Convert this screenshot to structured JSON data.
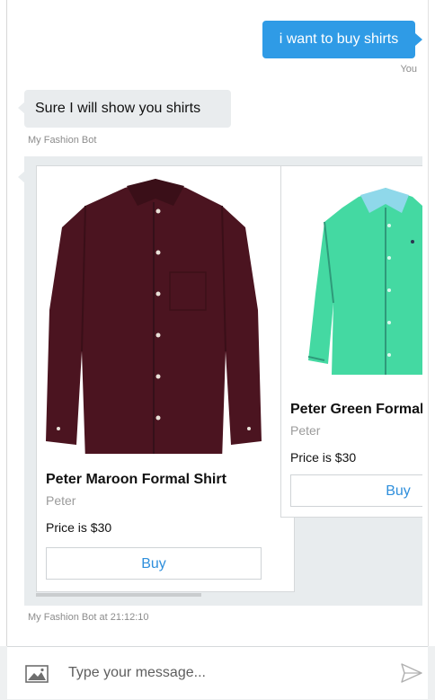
{
  "messages": {
    "user": {
      "text": "i want to buy shirts",
      "sender": "You"
    },
    "bot": {
      "text": "Sure I will show you shirts",
      "sender": "My Fashion Bot"
    }
  },
  "carousel": {
    "items": [
      {
        "title": "Peter Maroon Formal Shirt",
        "brand": "Peter",
        "price": "Price is $30",
        "button_label": "Buy",
        "shirt_color": "#4b1420"
      },
      {
        "title": "Peter Green Formal Shirt",
        "brand": "Peter",
        "price": "Price is $30",
        "button_label": "Buy",
        "shirt_color": "#44d9a2"
      }
    ],
    "timestamp": "My Fashion Bot at 21:12:10"
  },
  "composer": {
    "placeholder": "Type your message...",
    "attach_icon": "image-icon",
    "send_icon": "send-icon"
  },
  "colors": {
    "accent": "#2f9be6",
    "bot_bubble": "#e9ecee"
  }
}
